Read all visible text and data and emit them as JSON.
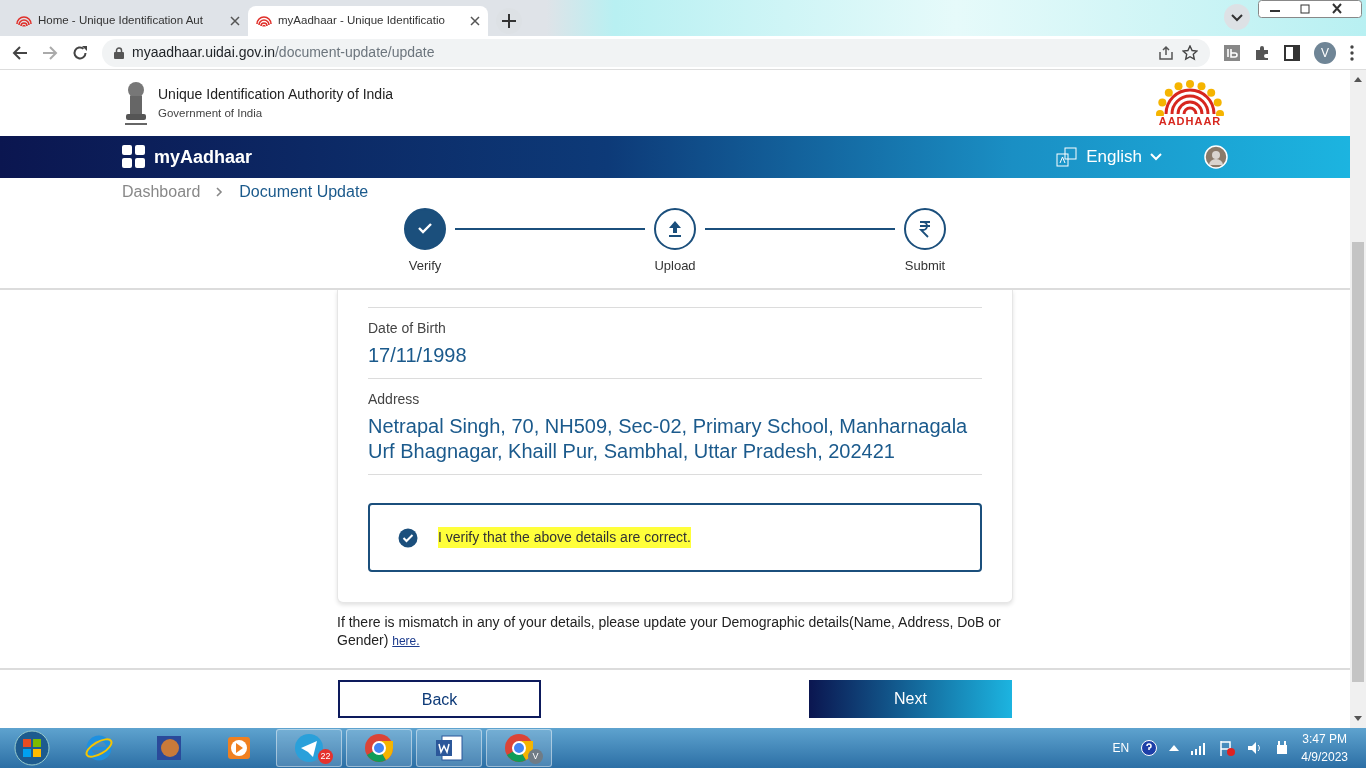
{
  "browser": {
    "tabs": [
      {
        "title": "Home - Unique Identification Aut",
        "selected": false
      },
      {
        "title": "myAadhaar - Unique Identificatio",
        "selected": true
      }
    ],
    "address_host": "myaadhaar.uidai.gov.in",
    "address_path": "/document-update/update",
    "profile": "V"
  },
  "header": {
    "org_name": "Unique Identification Authority of India",
    "org_sub": "Government of India",
    "logo_text": "AADHAAR"
  },
  "navbar": {
    "brand": "myAadhaar",
    "language": "English"
  },
  "breadcrumb": [
    {
      "label": "Dashboard",
      "current": false
    },
    {
      "label": "Document Update",
      "current": true
    }
  ],
  "steps": [
    {
      "label": "Verify",
      "kind": "check",
      "completed": true
    },
    {
      "label": "Upload",
      "kind": "upload",
      "completed": false
    },
    {
      "label": "Submit",
      "kind": "rupee",
      "completed": false
    }
  ],
  "fields": [
    {
      "label": "Date of Birth",
      "value": "17/11/1998"
    },
    {
      "label": "Address",
      "value": "Netrapal Singh, 70, NH509, Sec-02, Primary School, Manharnagala Urf Bhagnagar, Khaill Pur, Sambhal, Uttar Pradesh, 202421"
    }
  ],
  "consent": {
    "text": "I verify that the above details are correct.",
    "checked": true,
    "highlighted": true
  },
  "note": {
    "text": "If there is mismatch in any of your details, please update your Demographic details(Name, Address, DoB or Gender)",
    "link": "here."
  },
  "buttons": {
    "back": "Back",
    "next": "Next"
  },
  "taskbar": {
    "items": [
      {
        "kind": "ie"
      },
      {
        "kind": "media"
      },
      {
        "kind": "player"
      },
      {
        "kind": "telegram",
        "badge": "22"
      },
      {
        "kind": "chrome"
      },
      {
        "kind": "word"
      },
      {
        "kind": "chrome",
        "badge": "V"
      }
    ],
    "language": "EN",
    "time": "3:47 PM",
    "date": "4/9/2023"
  }
}
